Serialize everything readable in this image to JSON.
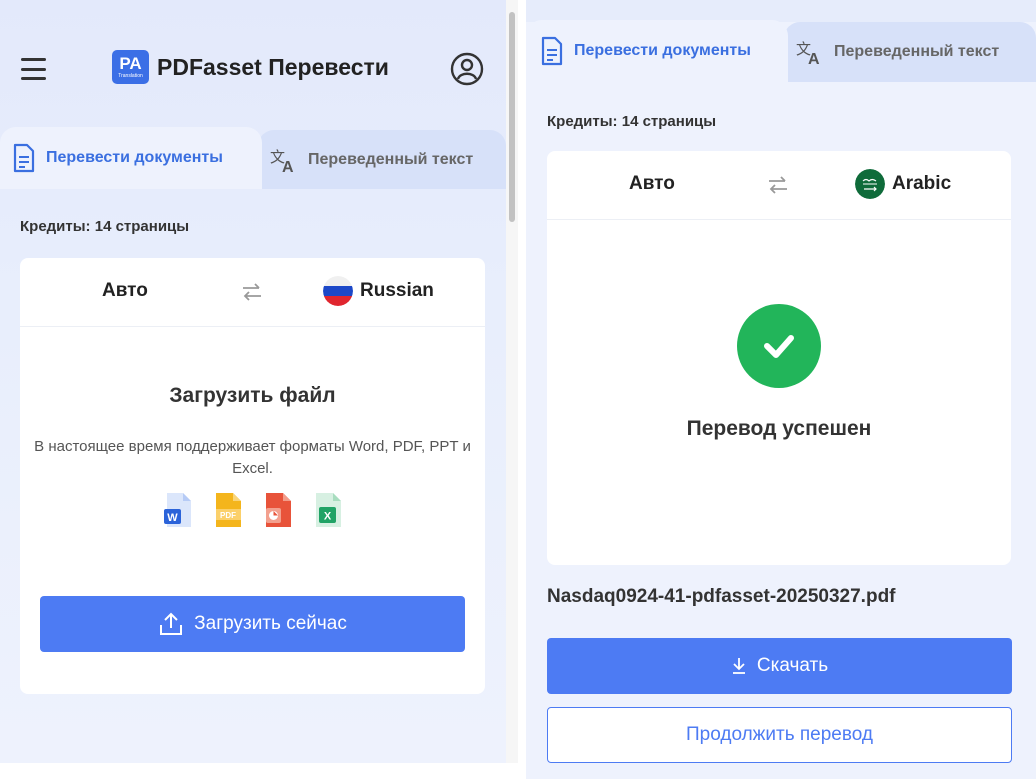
{
  "left": {
    "header": {
      "logo_text": "PA",
      "logo_sub": "Translation",
      "title": "PDFasset Перевести"
    },
    "tabs": [
      {
        "label": "Перевести документы",
        "icon": "document-icon",
        "active": true
      },
      {
        "label": "Переведенный текст",
        "icon": "translate-icon",
        "active": false
      }
    ],
    "credits": "Кредиты: 14 страницы",
    "languages": {
      "source": "Авто",
      "target": "Russian",
      "target_flag": "russia-flag"
    },
    "upload": {
      "title": "Загрузить файл",
      "description": "В настоящее время поддерживает форматы Word, PDF, PPT и Excel.",
      "formats": [
        {
          "name": "word",
          "color": "#2b63d9",
          "letter": "W"
        },
        {
          "name": "pdf",
          "color": "#f4b51c",
          "letter": "PDF"
        },
        {
          "name": "ppt",
          "color": "#e8533a",
          "letter": "P"
        },
        {
          "name": "excel",
          "color": "#21a366",
          "letter": "X"
        }
      ],
      "button_label": "Загрузить сейчас"
    }
  },
  "right": {
    "tabs": [
      {
        "label": "Перевести документы",
        "icon": "document-icon",
        "active": true
      },
      {
        "label": "Переведенный текст",
        "icon": "translate-icon",
        "active": false
      }
    ],
    "credits": "Кредиты: 14 страницы",
    "languages": {
      "source": "Авто",
      "target": "Arabic",
      "target_flag": "saudi-arabia-flag"
    },
    "status": "Перевод успешен",
    "filename": "Nasdaq0924-41-pdfasset-20250327.pdf",
    "download_label": "Скачать",
    "continue_label": "Продолжить перевод"
  },
  "colors": {
    "accent": "#4d7bf3",
    "tab_active_text": "#3a6fe0",
    "success": "#22b55a"
  }
}
